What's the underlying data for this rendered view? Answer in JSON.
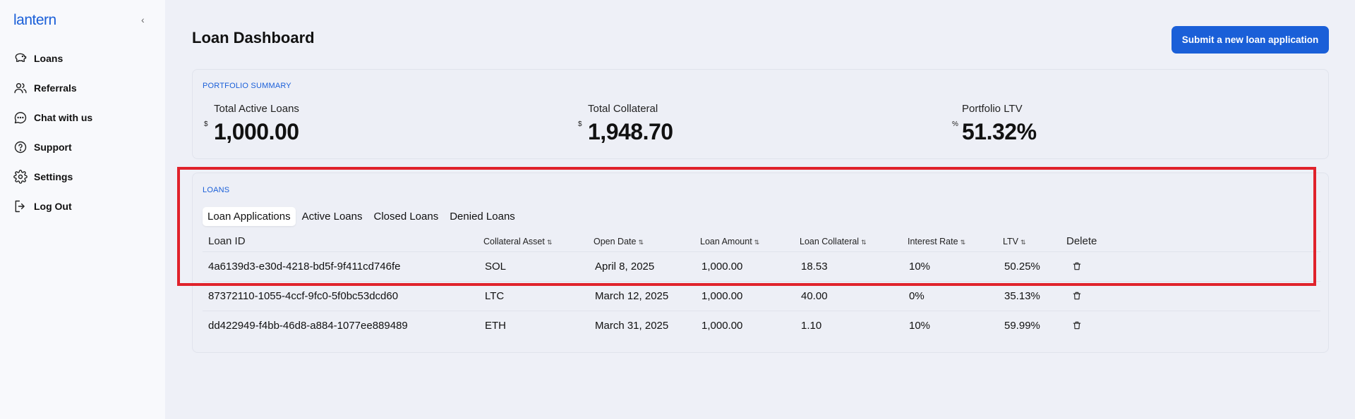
{
  "app": {
    "logo": "lantern"
  },
  "sidebar": {
    "collapse_icon": "‹",
    "items": [
      {
        "label": "Loans",
        "icon": "piggy-bank-icon"
      },
      {
        "label": "Referrals",
        "icon": "users-icon"
      },
      {
        "label": "Chat with us",
        "icon": "chat-icon"
      },
      {
        "label": "Support",
        "icon": "help-circle-icon"
      },
      {
        "label": "Settings",
        "icon": "gear-icon"
      },
      {
        "label": "Log Out",
        "icon": "logout-icon"
      }
    ]
  },
  "header": {
    "title": "Loan Dashboard",
    "submit_label": "Submit a new loan application"
  },
  "summary": {
    "section_label": "PORTFOLIO SUMMARY",
    "stats": [
      {
        "label": "Total Active Loans",
        "unit": "$",
        "value": "1,000.00"
      },
      {
        "label": "Total Collateral",
        "unit": "$",
        "value": "1,948.70"
      },
      {
        "label": "Portfolio LTV",
        "unit": "%",
        "value": "51.32%"
      }
    ]
  },
  "loans": {
    "section_label": "LOANS",
    "tabs": [
      "Loan Applications",
      "Active Loans",
      "Closed Loans",
      "Denied Loans"
    ],
    "active_tab": "Loan Applications",
    "sort_icon": "⇅",
    "columns": [
      "Loan ID",
      "Collateral Asset",
      "Open Date",
      "Loan Amount",
      "Loan Collateral",
      "Interest Rate",
      "LTV",
      "Delete"
    ],
    "rows": [
      {
        "id": "4a6139d3-e30d-4218-bd5f-9f411cd746fe",
        "asset": "SOL",
        "date": "April 8, 2025",
        "amount": "1,000.00",
        "collateral": "18.53",
        "rate": "10%",
        "ltv": "50.25%"
      },
      {
        "id": "87372110-1055-4ccf-9fc0-5f0bc53dcd60",
        "asset": "LTC",
        "date": "March 12, 2025",
        "amount": "1,000.00",
        "collateral": "40.00",
        "rate": "0%",
        "ltv": "35.13%"
      },
      {
        "id": "dd422949-f4bb-46d8-a884-1077ee889489",
        "asset": "ETH",
        "date": "March 31, 2025",
        "amount": "1,000.00",
        "collateral": "1.10",
        "rate": "10%",
        "ltv": "59.99%"
      }
    ]
  },
  "colors": {
    "accent": "#1a5fd8",
    "highlight": "#e0222b"
  }
}
